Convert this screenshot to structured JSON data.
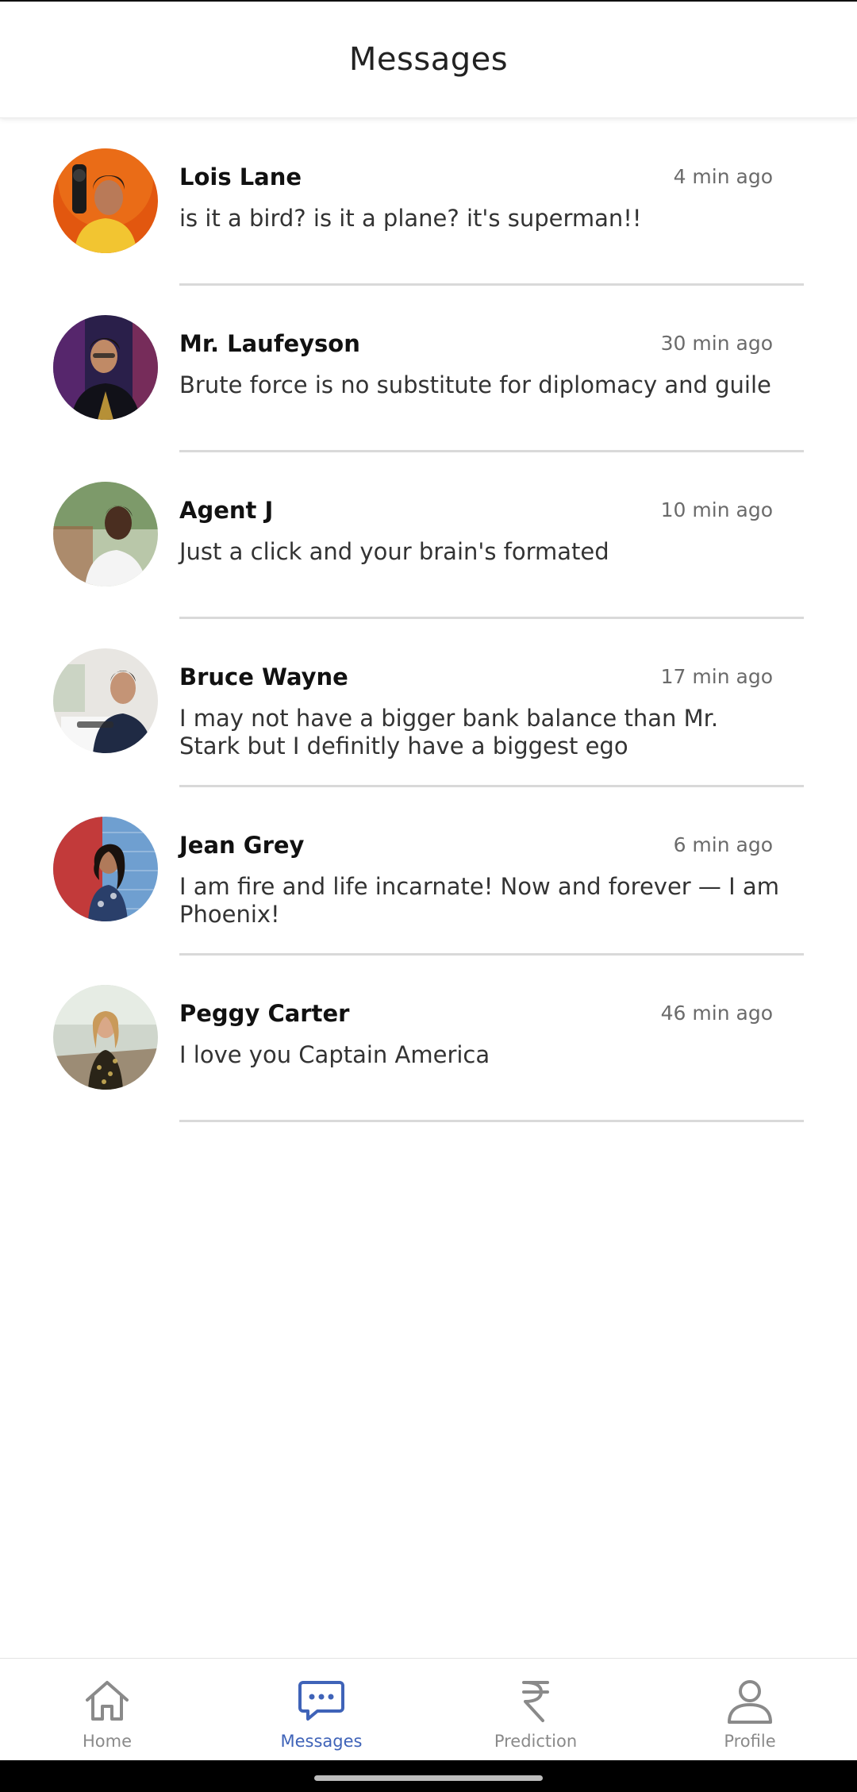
{
  "header": {
    "title": "Messages"
  },
  "colors": {
    "accent": "#3f63b8",
    "nav_inactive": "#8a8a8a",
    "divider": "#d9d9d9"
  },
  "messages": [
    {
      "name": "Lois Lane",
      "time": "4 min ago",
      "text": "is it a bird? is it a plane? it's superman!!"
    },
    {
      "name": "Mr. Laufeyson",
      "time": "30 min ago",
      "text": "Brute force is no substitute for diplomacy and guile"
    },
    {
      "name": "Agent J",
      "time": "10 min ago",
      "text": "Just a click and your brain's formated"
    },
    {
      "name": "Bruce Wayne",
      "time": "17 min ago",
      "text": "I may not have a bigger bank balance than Mr. Stark but I definitly have a biggest ego"
    },
    {
      "name": "Jean Grey",
      "time": "6 min ago",
      "text": "I am fire and life incarnate! Now and forever — I am Phoenix!"
    },
    {
      "name": "Peggy Carter",
      "time": "46 min ago",
      "text": "I love you Captain America"
    }
  ],
  "nav": {
    "items": [
      {
        "label": "Home",
        "icon": "home-icon"
      },
      {
        "label": "Messages",
        "icon": "chat-bubble-icon",
        "active": true
      },
      {
        "label": "Prediction",
        "icon": "rupee-icon"
      },
      {
        "label": "Profile",
        "icon": "person-icon"
      }
    ]
  }
}
